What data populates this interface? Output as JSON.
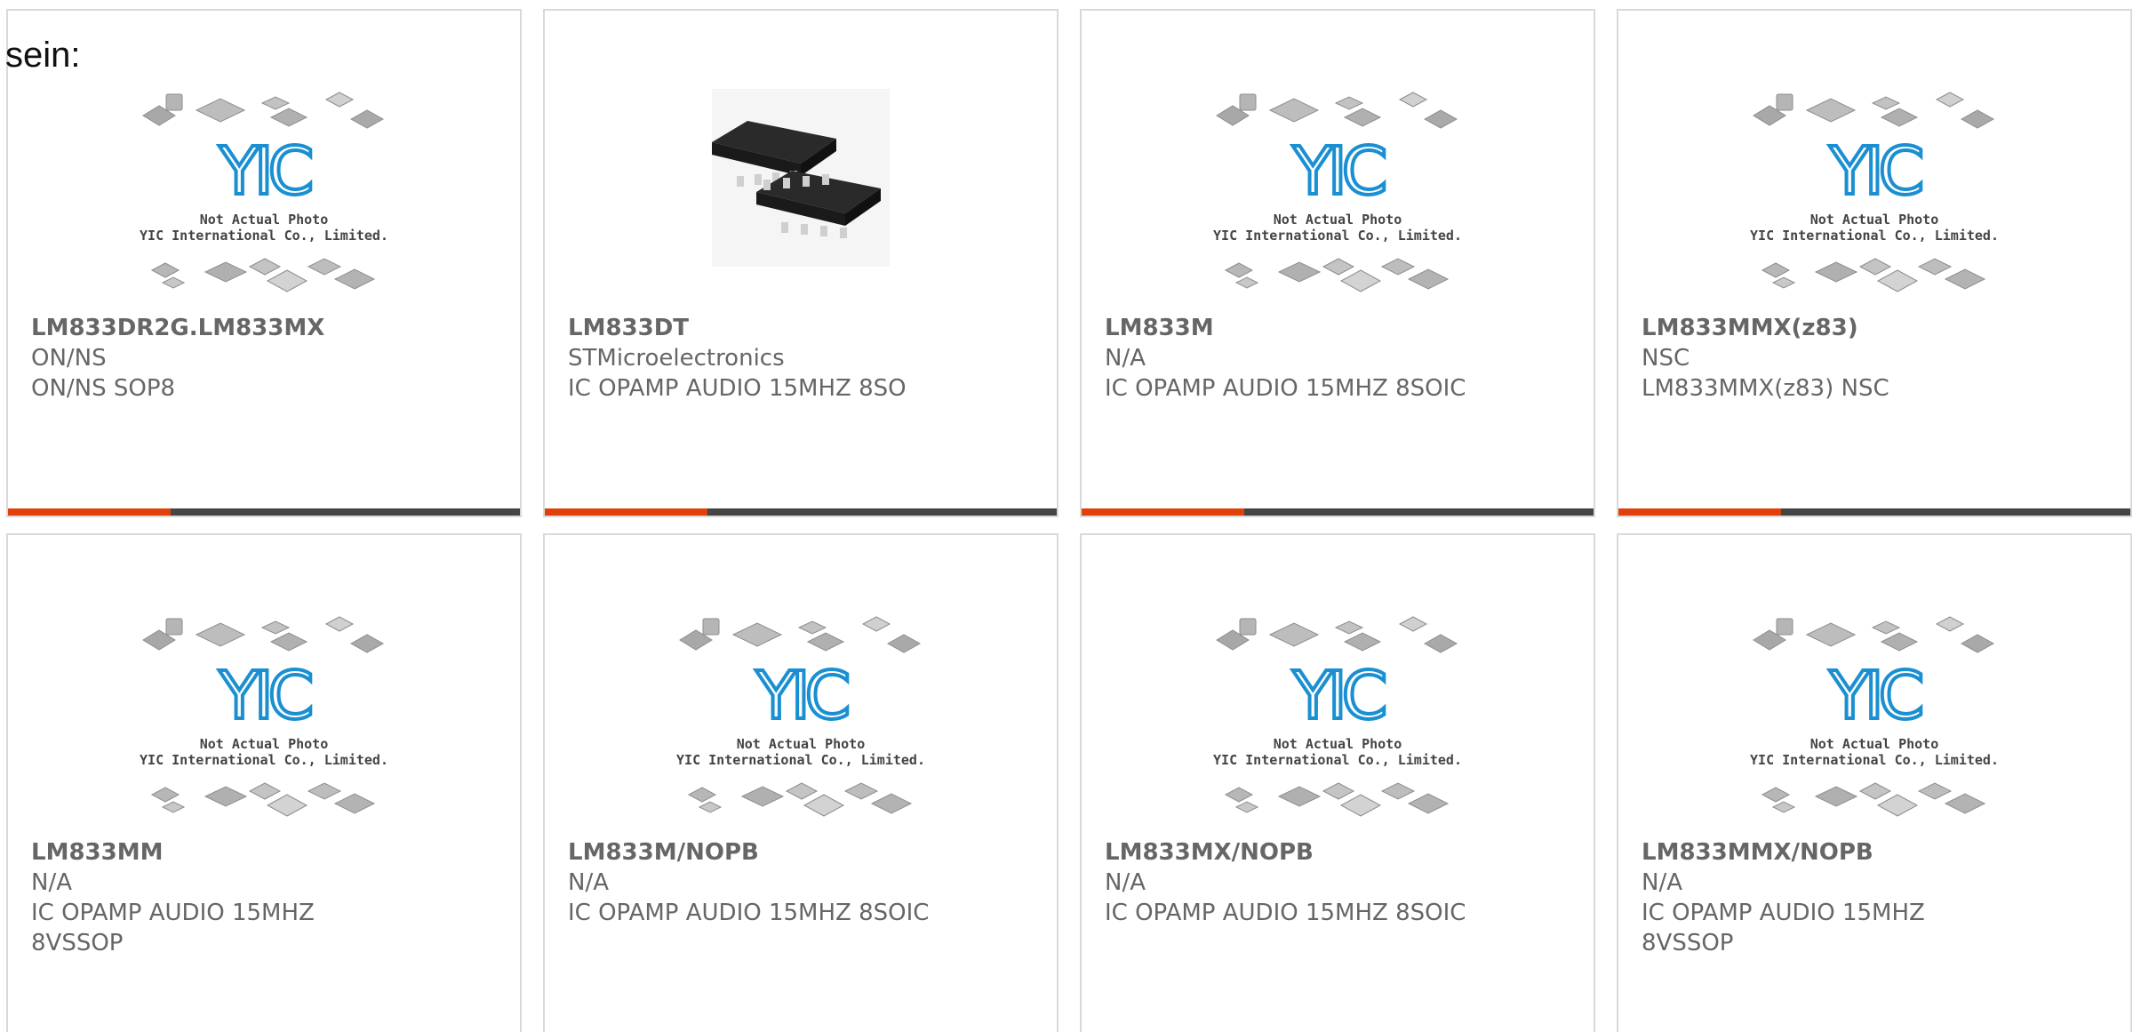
{
  "lead_text": "sein:",
  "placeholder": {
    "logo_text": "YIC",
    "caption_line1": "Not Actual Photo",
    "caption_line2": "YIC International Co., Limited."
  },
  "colors": {
    "accent": "#e0400a",
    "bar": "#444444",
    "logo": "#1a8fd1",
    "text": "#666666"
  },
  "products": [
    {
      "part": "LM833DR2G.LM833MX",
      "brand": "ON/NS",
      "desc": "ON/NS SOP8",
      "image": "placeholder"
    },
    {
      "part": "LM833DT",
      "brand": "STMicroelectronics",
      "desc": "IC OPAMP AUDIO 15MHZ 8SO",
      "image": "soic8-chip"
    },
    {
      "part": "LM833M",
      "brand": "N/A",
      "desc": "IC OPAMP AUDIO 15MHZ 8SOIC",
      "image": "placeholder"
    },
    {
      "part": "LM833MMX(z83)",
      "brand": "NSC",
      "desc": "LM833MMX(z83) NSC",
      "image": "placeholder"
    },
    {
      "part": "LM833MM",
      "brand": "N/A",
      "desc": "IC OPAMP AUDIO 15MHZ 8VSSOP",
      "image": "placeholder"
    },
    {
      "part": "LM833M/NOPB",
      "brand": "N/A",
      "desc": "IC OPAMP AUDIO 15MHZ 8SOIC",
      "image": "placeholder"
    },
    {
      "part": "LM833MX/NOPB",
      "brand": "N/A",
      "desc": "IC OPAMP AUDIO 15MHZ 8SOIC",
      "image": "placeholder"
    },
    {
      "part": "LM833MMX/NOPB",
      "brand": "N/A",
      "desc": "IC OPAMP AUDIO 15MHZ 8VSSOP",
      "image": "placeholder"
    }
  ]
}
